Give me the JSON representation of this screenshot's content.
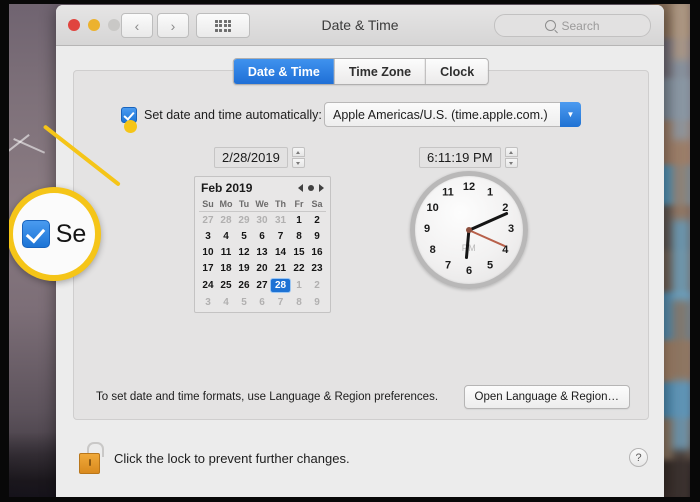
{
  "window": {
    "title": "Date & Time",
    "traffic_lights": [
      "close",
      "minimize",
      "zoom"
    ],
    "back_icon": "chevron-left-icon",
    "forward_icon": "chevron-right-icon",
    "showall_icon": "grid-icon",
    "search": {
      "placeholder": "Search",
      "icon": "search-icon"
    }
  },
  "tabs": [
    {
      "label": "Date & Time",
      "active": true
    },
    {
      "label": "Time Zone",
      "active": false
    },
    {
      "label": "Clock",
      "active": false
    }
  ],
  "auto": {
    "checkbox_checked": true,
    "label": "Set date and time automatically:",
    "server": "Apple Americas/U.S. (time.apple.com.)",
    "popup_icon": "chevron-down-icon"
  },
  "fields": {
    "date_value": "2/28/2019",
    "time_value": "6:11:19 PM",
    "stepper_icon": "stepper-arrows-icon"
  },
  "calendar": {
    "month_label": "Feb 2019",
    "prev_icon": "triangle-left-icon",
    "today_icon": "dot-icon",
    "next_icon": "triangle-right-icon",
    "weekdays": [
      "Su",
      "Mo",
      "Tu",
      "We",
      "Th",
      "Fr",
      "Sa"
    ],
    "selected_day": 28,
    "weeks": [
      [
        {
          "d": "27",
          "other": true
        },
        {
          "d": "28",
          "other": true
        },
        {
          "d": "29",
          "other": true
        },
        {
          "d": "30",
          "other": true
        },
        {
          "d": "31",
          "other": true
        },
        {
          "d": "1",
          "other": false
        },
        {
          "d": "2",
          "other": false
        }
      ],
      [
        {
          "d": "3",
          "other": false
        },
        {
          "d": "4",
          "other": false
        },
        {
          "d": "5",
          "other": false
        },
        {
          "d": "6",
          "other": false
        },
        {
          "d": "7",
          "other": false
        },
        {
          "d": "8",
          "other": false
        },
        {
          "d": "9",
          "other": false
        }
      ],
      [
        {
          "d": "10",
          "other": false
        },
        {
          "d": "11",
          "other": false
        },
        {
          "d": "12",
          "other": false
        },
        {
          "d": "13",
          "other": false
        },
        {
          "d": "14",
          "other": false
        },
        {
          "d": "15",
          "other": false
        },
        {
          "d": "16",
          "other": false
        }
      ],
      [
        {
          "d": "17",
          "other": false
        },
        {
          "d": "18",
          "other": false
        },
        {
          "d": "19",
          "other": false
        },
        {
          "d": "20",
          "other": false
        },
        {
          "d": "21",
          "other": false
        },
        {
          "d": "22",
          "other": false
        },
        {
          "d": "23",
          "other": false
        }
      ],
      [
        {
          "d": "24",
          "other": false
        },
        {
          "d": "25",
          "other": false
        },
        {
          "d": "26",
          "other": false
        },
        {
          "d": "27",
          "other": false
        },
        {
          "d": "28",
          "other": false,
          "selected": true
        },
        {
          "d": "1",
          "other": true
        },
        {
          "d": "2",
          "other": true
        }
      ],
      [
        {
          "d": "3",
          "other": true
        },
        {
          "d": "4",
          "other": true
        },
        {
          "d": "5",
          "other": true
        },
        {
          "d": "6",
          "other": true
        },
        {
          "d": "7",
          "other": true
        },
        {
          "d": "8",
          "other": true
        },
        {
          "d": "9",
          "other": true
        }
      ]
    ]
  },
  "clock": {
    "numerals": [
      "12",
      "1",
      "2",
      "3",
      "4",
      "5",
      "6",
      "7",
      "8",
      "9",
      "10",
      "11"
    ],
    "ampm": "PM",
    "hour": 6,
    "minute": 11,
    "second": 19,
    "hour_angle": 185,
    "minute_angle": 66,
    "second_angle": 114,
    "second_hand_color": "#b8604a"
  },
  "footer": {
    "formats_note": "To set date and time formats, use Language & Region preferences.",
    "open_language_button": "Open Language & Region…"
  },
  "lock": {
    "icon": "unlocked-padlock-icon",
    "text": "Click the lock to prevent further changes.",
    "help_button": "?"
  },
  "callout": {
    "checkbox_checked": true,
    "label": "Se",
    "ring_color": "#f5c518"
  }
}
